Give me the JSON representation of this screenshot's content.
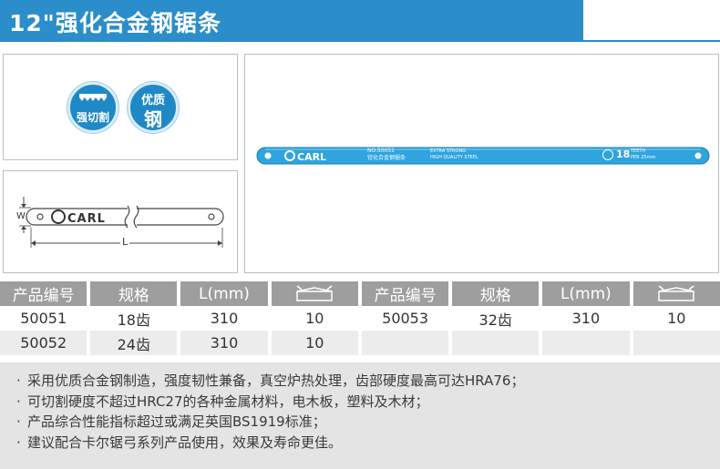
{
  "title": "12\"强化合金钢锯条",
  "badges": [
    {
      "label": "强切割"
    },
    {
      "label_top": "优质",
      "label_bottom": "钢"
    }
  ],
  "diagram": {
    "w_label": "W",
    "l_label": "L",
    "brand": "CARL"
  },
  "blade": {
    "brand": "CARL",
    "no": "NO.50051",
    "sub": "铨化合金钢锯条",
    "extra1": "EXTRA STRONG",
    "extra2": "HIGH QUALITY STEEL",
    "teeth_num": "18",
    "teeth_l1": "TEETH",
    "teeth_l2": "PER 25mm",
    "color": "#2fa4dd"
  },
  "table": {
    "headers": [
      "产品编号",
      "规格",
      "L(mm)",
      "package-icon",
      "产品编号",
      "规格",
      "L(mm)",
      "package-icon"
    ],
    "rows": [
      [
        "50051",
        "18齿",
        "310",
        "10",
        "50053",
        "32齿",
        "310",
        "10"
      ],
      [
        "50052",
        "24齿",
        "310",
        "10",
        "",
        "",
        "",
        ""
      ]
    ]
  },
  "features": [
    "采用优质合金钢制造，强度韧性兼备，真空炉热处理，齿部硬度最高可达HRA76；",
    "可切割硬度不超过HRC27的各种金属材料，电木板，塑料及木材；",
    "产品综合性能指标超过或满足英国BS1919标准；",
    "建议配合卡尔锯弓系列产品使用，效果及寿命更佳。"
  ],
  "colors": {
    "accent": "#2b8dc9",
    "header_gray": "#9e9e9e",
    "stripe": "#ececec",
    "panel": "#e4e4e4"
  }
}
